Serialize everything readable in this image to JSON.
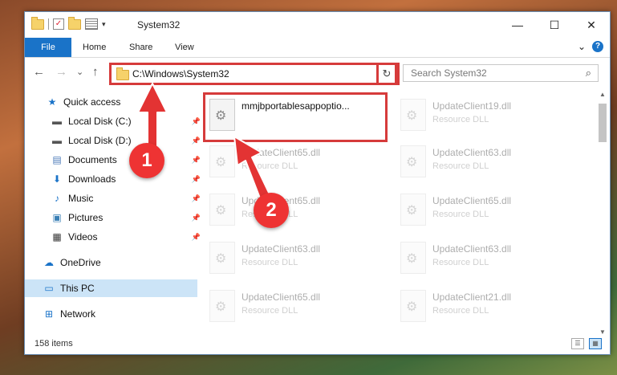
{
  "window": {
    "title": "System32",
    "minimize": "—",
    "maximize": "☐",
    "close": "✕"
  },
  "ribbon": {
    "tabs": [
      "File",
      "Home",
      "Share",
      "View"
    ],
    "expand": "⌄",
    "help": "?"
  },
  "nav": {
    "back": "←",
    "forward": "→",
    "recent": "⌄",
    "up": "↑",
    "address": "C:\\Windows\\System32",
    "address_dropdown": "⌄",
    "refresh": "↻",
    "search_placeholder": "Search System32",
    "search_icon": "⌕"
  },
  "sidebar": {
    "items": [
      {
        "label": "Quick access",
        "icon": "star-icon",
        "glyph": "★",
        "pinned": false
      },
      {
        "label": "Local Disk (C:)",
        "icon": "drive-icon",
        "glyph": "▬",
        "pinned": true
      },
      {
        "label": "Local Disk (D:)",
        "icon": "drive-icon",
        "glyph": "▬",
        "pinned": true
      },
      {
        "label": "Documents",
        "icon": "documents-icon",
        "glyph": "▤",
        "pinned": true
      },
      {
        "label": "Downloads",
        "icon": "download-icon",
        "glyph": "⬇",
        "pinned": true
      },
      {
        "label": "Music",
        "icon": "music-icon",
        "glyph": "♪",
        "pinned": true
      },
      {
        "label": "Pictures",
        "icon": "pictures-icon",
        "glyph": "▣",
        "pinned": true
      },
      {
        "label": "Videos",
        "icon": "videos-icon",
        "glyph": "▦",
        "pinned": true
      },
      {
        "label": "OneDrive",
        "icon": "cloud-icon",
        "glyph": "☁",
        "pinned": false
      },
      {
        "label": "This PC",
        "icon": "computer-icon",
        "glyph": "▭",
        "pinned": false
      },
      {
        "label": "Network",
        "icon": "network-icon",
        "glyph": "⊞",
        "pinned": false
      }
    ],
    "pin_glyph": "📌"
  },
  "files": {
    "highlighted": {
      "name": "mmjbportablesappoptio...",
      "type": ""
    },
    "background": [
      {
        "name": "UpdateClient19.dll",
        "type": "Resource DLL"
      },
      {
        "name": "UpdateClient65.dll",
        "type": "Resource DLL"
      },
      {
        "name": "UpdateClient63.dll",
        "type": "Resource DLL"
      },
      {
        "name": "UpdateClient65.dll",
        "type": "Resource DLL"
      },
      {
        "name": "UpdateClient65.dll",
        "type": "Resource DLL"
      },
      {
        "name": "UpdateClient63.dll",
        "type": "Resource DLL"
      },
      {
        "name": "UpdateClient63.dll",
        "type": "Resource DLL"
      },
      {
        "name": "UpdateClient65.dll",
        "type": "Resource DLL"
      },
      {
        "name": "UpdateClient21.dll",
        "type": "Resource DLL"
      }
    ]
  },
  "status": {
    "item_count": "158 items"
  },
  "annotations": {
    "step1": "1",
    "step2": "2",
    "color": "#e33333"
  }
}
